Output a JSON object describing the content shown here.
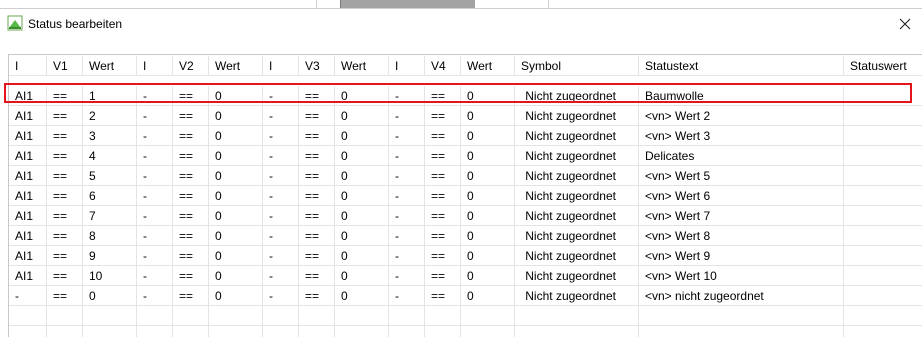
{
  "window": {
    "title": "Status bearbeiten",
    "close_glyph": "✕"
  },
  "columns": [
    "I",
    "V1",
    "Wert",
    "I",
    "V2",
    "Wert",
    "I",
    "V3",
    "Wert",
    "I",
    "V4",
    "Wert",
    "Symbol",
    "Statustext",
    "Statuswert"
  ],
  "rows": [
    [
      "AI1",
      "==",
      "1",
      "-",
      "==",
      "0",
      "-",
      "==",
      "0",
      "-",
      "==",
      "0",
      "Nicht zugeordnet",
      "Baumwolle",
      ""
    ],
    [
      "AI1",
      "==",
      "2",
      "-",
      "==",
      "0",
      "-",
      "==",
      "0",
      "-",
      "==",
      "0",
      "Nicht zugeordnet",
      "<vn> Wert 2",
      ""
    ],
    [
      "AI1",
      "==",
      "3",
      "-",
      "==",
      "0",
      "-",
      "==",
      "0",
      "-",
      "==",
      "0",
      "Nicht zugeordnet",
      "<vn> Wert 3",
      ""
    ],
    [
      "AI1",
      "==",
      "4",
      "-",
      "==",
      "0",
      "-",
      "==",
      "0",
      "-",
      "==",
      "0",
      "Nicht zugeordnet",
      "Delicates",
      ""
    ],
    [
      "AI1",
      "==",
      "5",
      "-",
      "==",
      "0",
      "-",
      "==",
      "0",
      "-",
      "==",
      "0",
      "Nicht zugeordnet",
      "<vn> Wert 5",
      ""
    ],
    [
      "AI1",
      "==",
      "6",
      "-",
      "==",
      "0",
      "-",
      "==",
      "0",
      "-",
      "==",
      "0",
      "Nicht zugeordnet",
      "<vn> Wert 6",
      ""
    ],
    [
      "AI1",
      "==",
      "7",
      "-",
      "==",
      "0",
      "-",
      "==",
      "0",
      "-",
      "==",
      "0",
      "Nicht zugeordnet",
      "<vn> Wert 7",
      ""
    ],
    [
      "AI1",
      "==",
      "8",
      "-",
      "==",
      "0",
      "-",
      "==",
      "0",
      "-",
      "==",
      "0",
      "Nicht zugeordnet",
      "<vn> Wert 8",
      ""
    ],
    [
      "AI1",
      "==",
      "9",
      "-",
      "==",
      "0",
      "-",
      "==",
      "0",
      "-",
      "==",
      "0",
      "Nicht zugeordnet",
      "<vn> Wert 9",
      ""
    ],
    [
      "AI1",
      "==",
      "10",
      "-",
      "==",
      "0",
      "-",
      "==",
      "0",
      "-",
      "==",
      "0",
      "Nicht zugeordnet",
      "<vn> Wert 10",
      ""
    ],
    [
      "-",
      "==",
      "0",
      "-",
      "==",
      "0",
      "-",
      "==",
      "0",
      "-",
      "==",
      "0",
      "Nicht zugeordnet",
      "<vn> nicht zugeordnet",
      ""
    ],
    [
      "",
      "",
      "",
      "",
      "",
      "",
      "",
      "",
      "",
      "",
      "",
      "",
      "",
      "",
      ""
    ],
    [
      "",
      "",
      "",
      "",
      "",
      "",
      "",
      "",
      "",
      "",
      "",
      "",
      "",
      "",
      ""
    ]
  ],
  "selected_row": 0,
  "colors": {
    "selection_border": "#e3141b",
    "grid_line": "#e4e4e4",
    "app_icon_green": "#4caf50"
  },
  "icons": {
    "app": "status-edit-icon",
    "close": "close-icon"
  }
}
